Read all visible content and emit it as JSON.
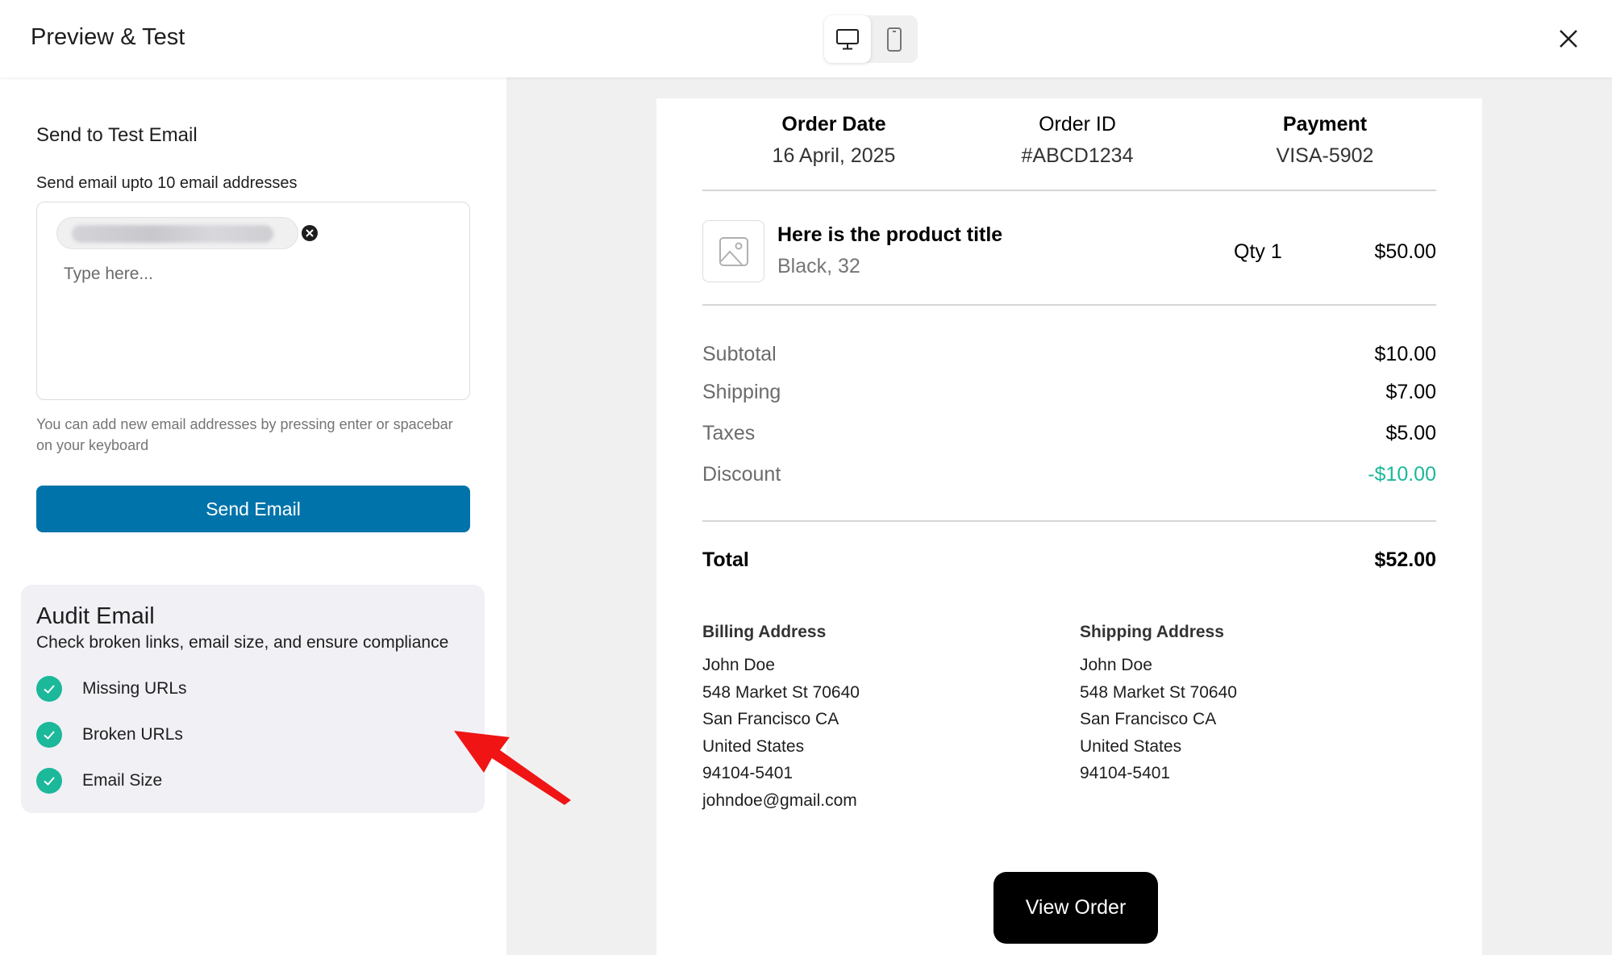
{
  "header": {
    "title": "Preview & Test",
    "device_toggle": {
      "desktop_icon": "desktop-icon",
      "mobile_icon": "mobile-icon",
      "active": "desktop"
    },
    "close_icon": "close-icon"
  },
  "test_email": {
    "section_title": "Send to Test Email",
    "field_label": "Send email upto 10 email addresses",
    "chip_value": "",
    "input_value": "",
    "input_placeholder": "Type here...",
    "helper_text": "You can add new email addresses by pressing enter or spacebar on your keyboard",
    "send_label": "Send Email"
  },
  "audit": {
    "title": "Audit Email",
    "subtitle": "Check broken links, email size, and ensure compliance",
    "checks": [
      {
        "label": "Missing URLs",
        "status": "passed"
      },
      {
        "label": "Broken URLs",
        "status": "passed"
      },
      {
        "label": "Email Size",
        "status": "passed"
      }
    ]
  },
  "email_preview": {
    "meta": [
      {
        "label": "Order Date",
        "value": "16 April, 2025"
      },
      {
        "label": "Order ID",
        "value": "#ABCD1234"
      },
      {
        "label": "Payment",
        "value": "VISA-5902"
      }
    ],
    "product": {
      "title": "Here is the product title",
      "variant": "Black, 32",
      "qty": "Qty 1",
      "price": "$50.00",
      "image_icon": "image-placeholder-icon"
    },
    "summary": [
      {
        "label": "Subtotal",
        "value": "$10.00"
      },
      {
        "label": "Shipping",
        "value": "$7.00"
      },
      {
        "label": "Taxes",
        "value": "$5.00"
      },
      {
        "label": "Discount",
        "value": "-$10.00"
      }
    ],
    "total": {
      "label": "Total",
      "value": "$52.00"
    },
    "billing": {
      "heading": "Billing Address",
      "lines": [
        "John Doe",
        "548 Market St 70640",
        "San Francisco CA",
        "United States",
        "94104-5401",
        "johndoe@gmail.com"
      ]
    },
    "shipping": {
      "heading": "Shipping Address",
      "lines": [
        "John Doe",
        "548 Market St 70640",
        "San Francisco CA",
        "United States",
        "94104-5401"
      ]
    },
    "cta_label": "View Order"
  },
  "colors": {
    "primary": "#0073aa",
    "success": "#1bb89a",
    "annotation_arrow": "#f01414"
  }
}
